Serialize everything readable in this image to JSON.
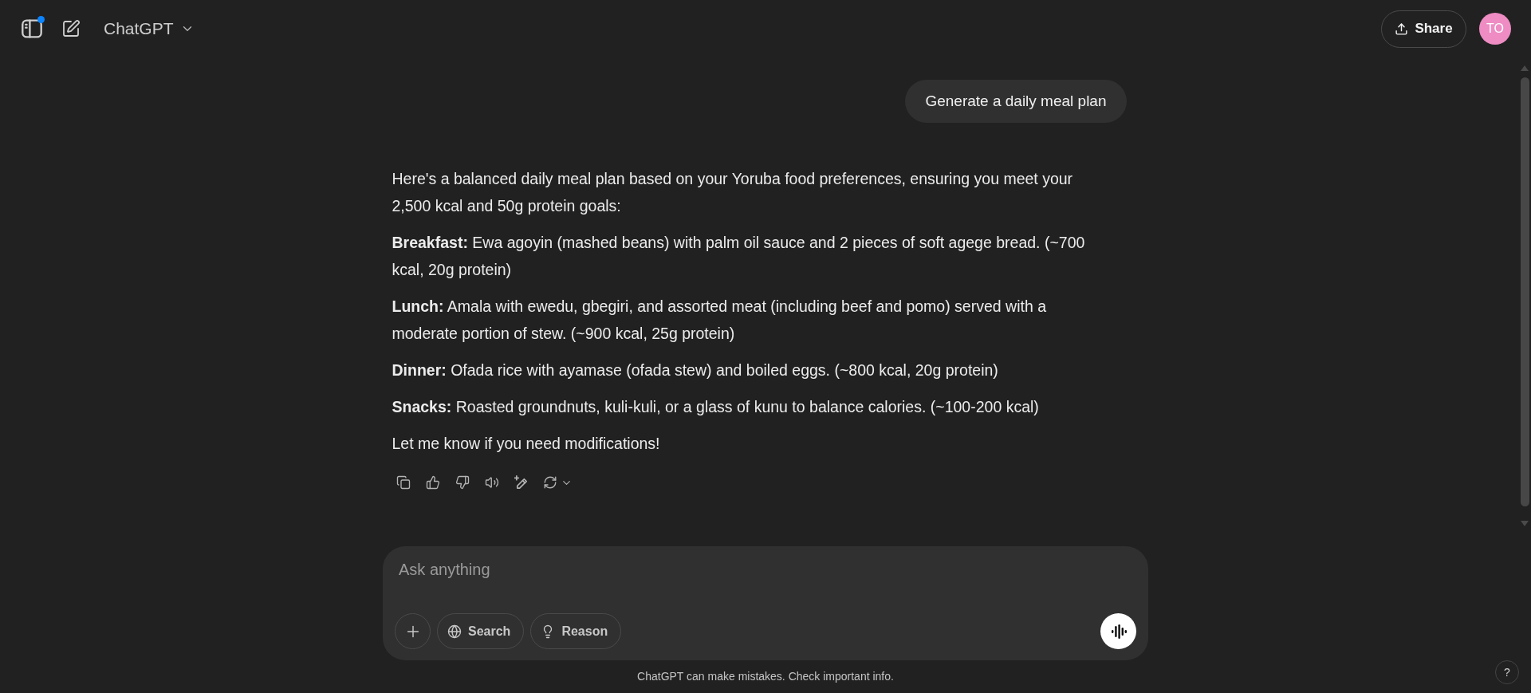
{
  "header": {
    "sidebar_button": {
      "notification": true
    },
    "title": "ChatGPT",
    "share": {
      "label": "Share"
    },
    "avatar": {
      "initials": "TO"
    }
  },
  "thread": {
    "user_message": "Generate a daily meal plan",
    "assistant_paragraphs": [
      "Here's a balanced daily meal plan based on your Yoruba food preferences, ensuring you meet your 2,500 kcal and 50g protein goals:",
      "**Breakfast:** Ewa agoyin (mashed beans) with palm oil sauce and 2 pieces of soft agege bread. (~700 kcal, 20g protein)",
      "**Lunch:** Amala with ewedu, gbegiri, and assorted meat (including beef and pomo) served with a moderate portion of stew. (~900 kcal, 25g protein)",
      "**Dinner:** Ofada rice with ayamase (ofada stew) and boiled eggs. (~800 kcal, 20g protein)",
      "**Snacks:** Roasted groundnuts, kuli-kuli, or a glass of kunu to balance calories. (~100-200 kcal)",
      "Let me know if you need modifications!"
    ]
  },
  "composer": {
    "placeholder": "Ask anything",
    "tools": [
      {
        "kind": "search",
        "label": "Search"
      },
      {
        "kind": "reason",
        "label": "Reason"
      }
    ]
  },
  "disclaimer": "ChatGPT can make mistakes. Check important info.",
  "help_button": {
    "label": "?"
  }
}
